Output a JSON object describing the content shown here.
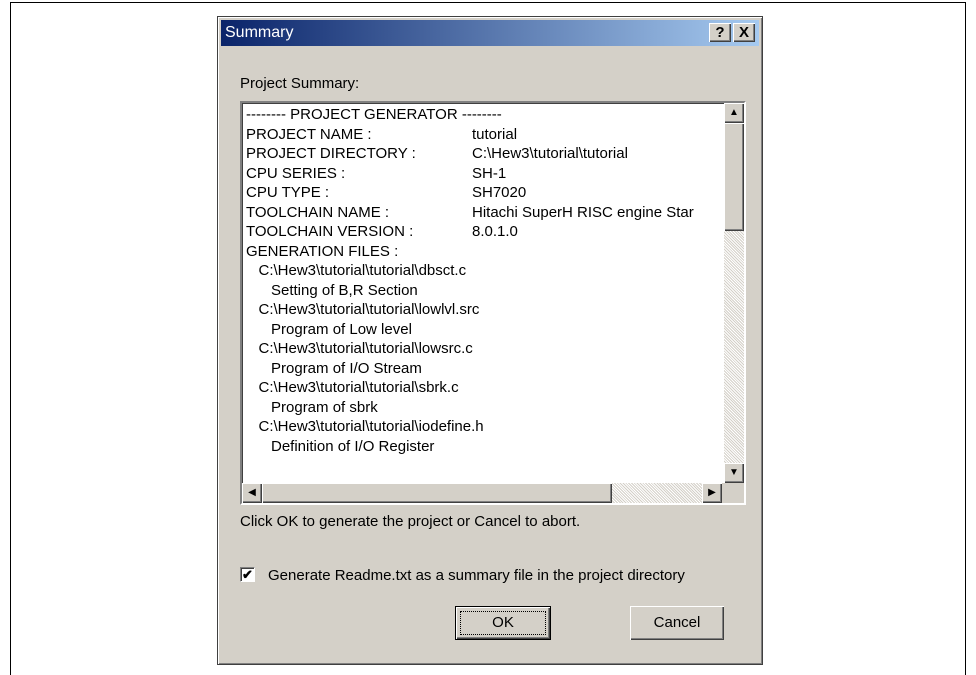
{
  "dialog": {
    "title": "Summary",
    "help_glyph": "?",
    "close_glyph": "X"
  },
  "summary_label": "Project Summary:",
  "summary_lines": [
    {
      "key": "-------- PROJECT GENERATOR --------",
      "value": ""
    },
    {
      "key": "PROJECT NAME :",
      "value": "tutorial"
    },
    {
      "key": "PROJECT DIRECTORY :",
      "value": "C:\\Hew3\\tutorial\\tutorial"
    },
    {
      "key": "CPU SERIES :",
      "value": "SH-1"
    },
    {
      "key": "CPU TYPE :",
      "value": "SH7020"
    },
    {
      "key": "TOOLCHAIN NAME :",
      "value": "Hitachi SuperH RISC engine Star"
    },
    {
      "key": "TOOLCHAIN VERSION :",
      "value": "8.0.1.0"
    },
    {
      "key": "GENERATION FILES :",
      "value": ""
    },
    {
      "key": "   C:\\Hew3\\tutorial\\tutorial\\dbsct.c",
      "value": ""
    },
    {
      "key": "      Setting of B,R Section",
      "value": ""
    },
    {
      "key": "   C:\\Hew3\\tutorial\\tutorial\\lowlvl.src",
      "value": ""
    },
    {
      "key": "      Program of Low level",
      "value": ""
    },
    {
      "key": "   C:\\Hew3\\tutorial\\tutorial\\lowsrc.c",
      "value": ""
    },
    {
      "key": "      Program of I/O Stream",
      "value": ""
    },
    {
      "key": "   C:\\Hew3\\tutorial\\tutorial\\sbrk.c",
      "value": ""
    },
    {
      "key": "      Program of sbrk",
      "value": ""
    },
    {
      "key": "   C:\\Hew3\\tutorial\\tutorial\\iodefine.h",
      "value": ""
    },
    {
      "key": "      Definition of I/O Register",
      "value": ""
    }
  ],
  "scroll": {
    "up": "▲",
    "down": "▼",
    "left": "◀",
    "right": "▶"
  },
  "info_text": "Click OK to generate the project or Cancel to abort.",
  "readme_checkbox": {
    "checked": true,
    "check_glyph": "✔",
    "label": "Generate Readme.txt as a summary file in the project directory"
  },
  "buttons": {
    "ok": "OK",
    "cancel": "Cancel"
  }
}
